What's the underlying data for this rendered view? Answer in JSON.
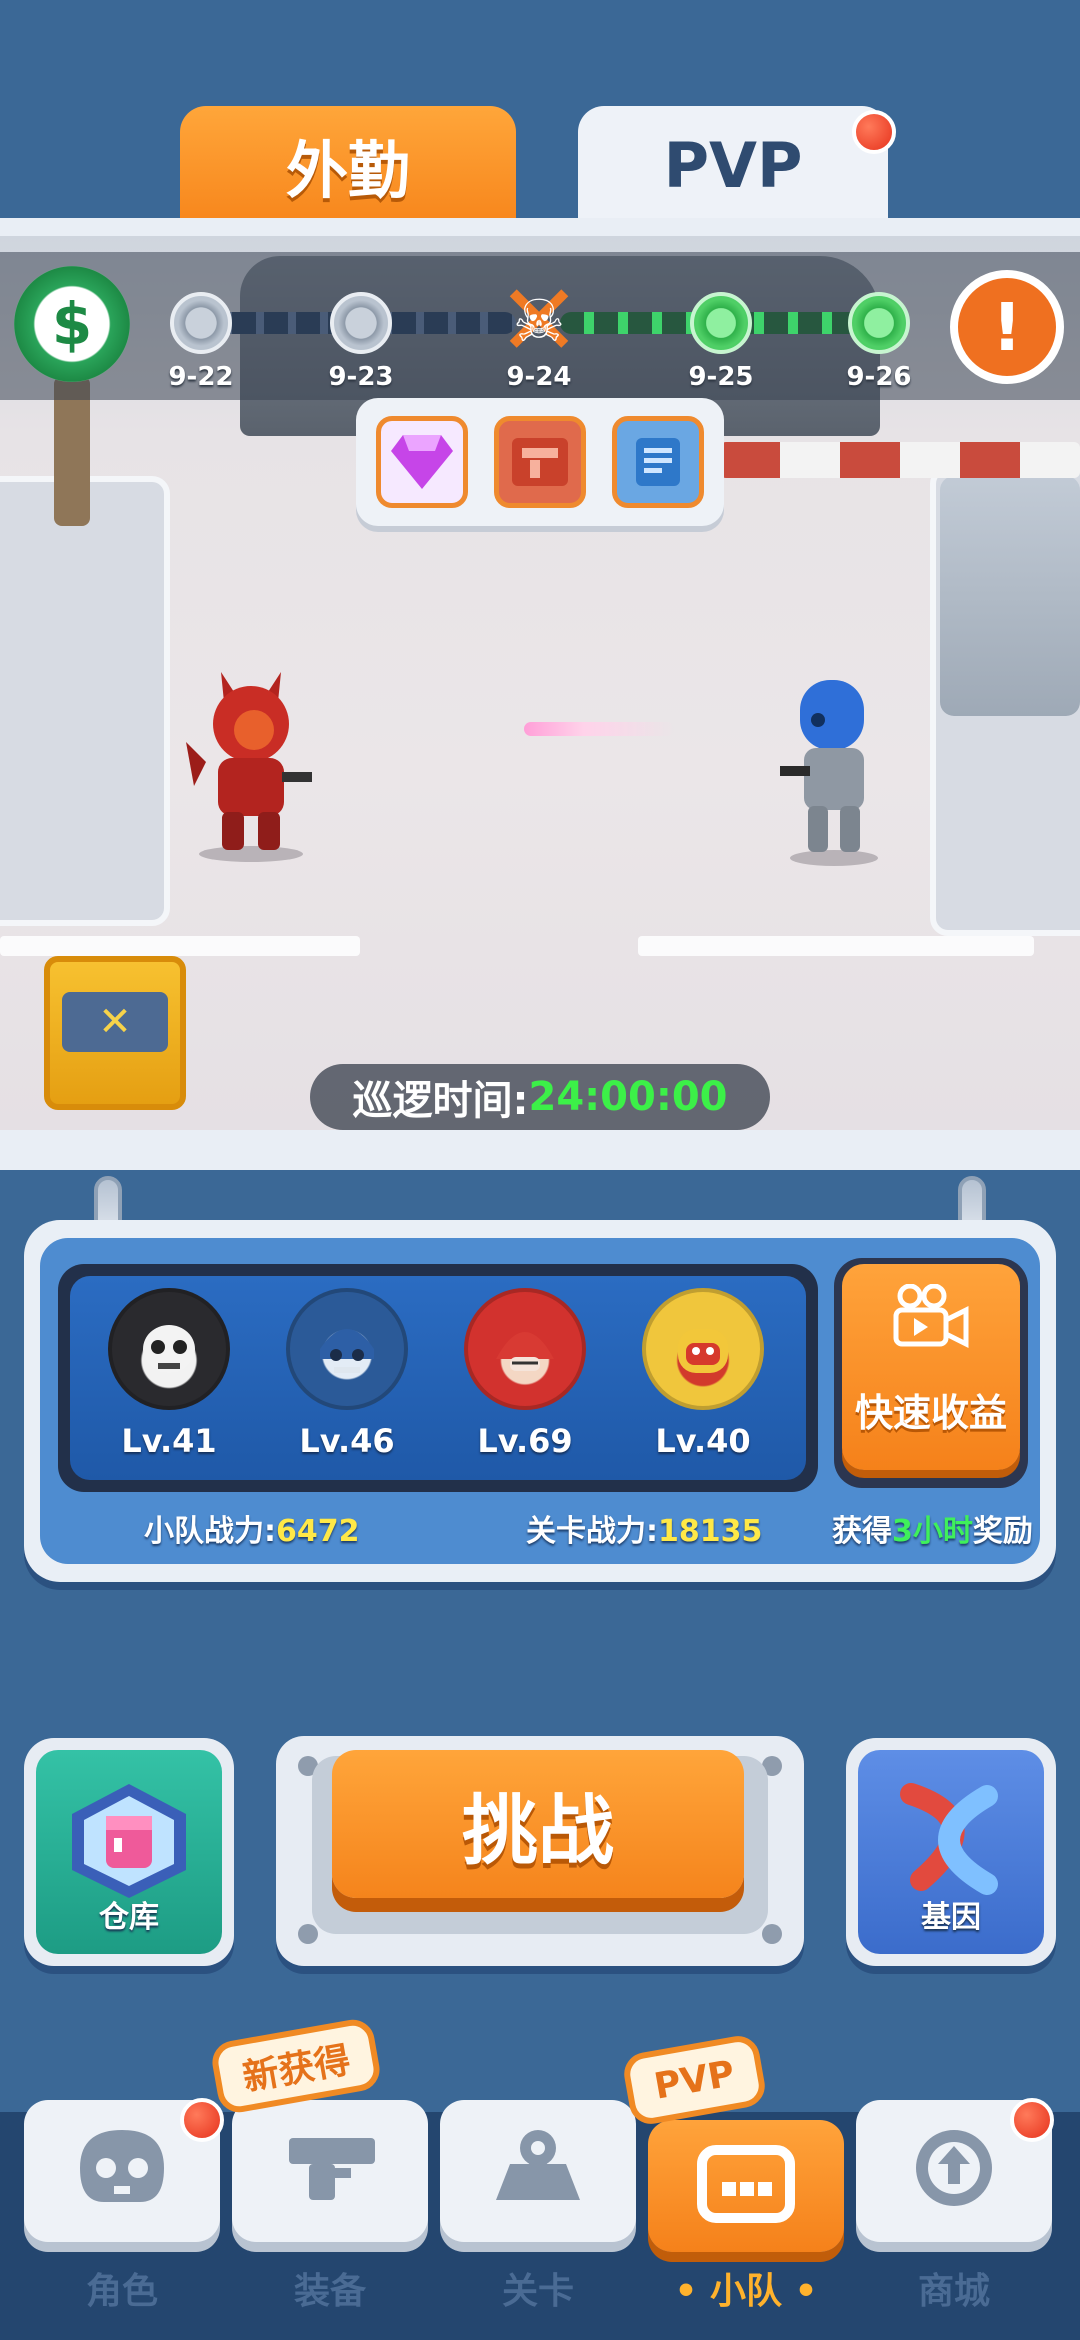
{
  "tabs": {
    "patrol_label": "外勤",
    "pvp_label": "PVP"
  },
  "stages": [
    {
      "label": "9-22",
      "state": "cleared"
    },
    {
      "label": "9-23",
      "state": "cleared"
    },
    {
      "label": "9-24",
      "state": "boss"
    },
    {
      "label": "9-25",
      "state": "upcoming"
    },
    {
      "label": "9-26",
      "state": "upcoming"
    }
  ],
  "stage_rewards": [
    "gem-icon",
    "equipment-card-icon",
    "scroll-icon"
  ],
  "patrol": {
    "label": "巡逻时间:",
    "time": "24:00:00"
  },
  "squad": {
    "heroes": [
      {
        "level": "Lv.41",
        "icon": "reaper-avatar"
      },
      {
        "level": "Lv.46",
        "icon": "blue-helmet-avatar"
      },
      {
        "level": "Lv.69",
        "icon": "red-hood-avatar"
      },
      {
        "level": "Lv.40",
        "icon": "yellow-monster-avatar"
      }
    ],
    "quick_earnings_label": "快速收益",
    "squad_power_label": "小队战力:",
    "squad_power_value": "6472",
    "stage_power_label": "关卡战力:",
    "stage_power_value": "18135",
    "reward_prefix": "获得",
    "reward_hours": "3小时",
    "reward_suffix": "奖励"
  },
  "actions": {
    "warehouse_label": "仓库",
    "challenge_label": "挑战",
    "gene_label": "基因"
  },
  "nav": {
    "items": [
      {
        "label": "角色",
        "icon": "character-icon",
        "badge": true
      },
      {
        "label": "装备",
        "icon": "equipment-icon",
        "tag": "新获得"
      },
      {
        "label": "关卡",
        "icon": "map-icon"
      },
      {
        "label": "小队",
        "icon": "squad-icon",
        "active": true,
        "tag": "PVP"
      },
      {
        "label": "商城",
        "icon": "shop-icon",
        "badge": true
      }
    ]
  },
  "colors": {
    "accent_orange": "#f7861c",
    "highlight_green": "#3cf048",
    "highlight_yellow": "#ffe847",
    "background_blue": "#3b6896"
  }
}
